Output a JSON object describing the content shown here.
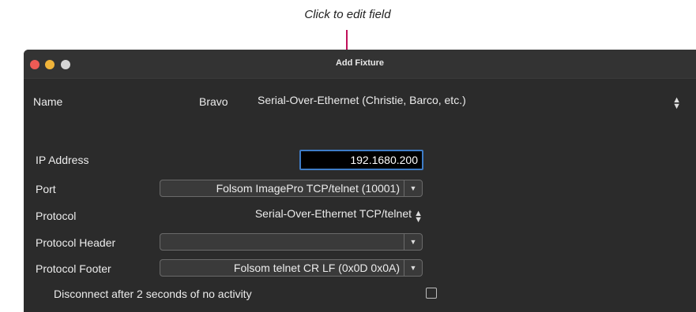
{
  "annotation": {
    "text": "Click to edit field"
  },
  "window": {
    "title": "Add Fixture"
  },
  "name_row": {
    "label": "Name",
    "value": "Bravo",
    "type_selected": "Serial-Over-Ethernet (Christie, Barco, etc.)"
  },
  "ip": {
    "label": "IP Address",
    "value": "192.1680.200"
  },
  "port": {
    "label": "Port",
    "selected": "Folsom ImagePro TCP/telnet (10001)"
  },
  "protocol": {
    "label": "Protocol",
    "selected": "Serial-Over-Ethernet TCP/telnet"
  },
  "protocol_header": {
    "label": "Protocol Header",
    "selected": ""
  },
  "protocol_footer": {
    "label": "Protocol Footer",
    "selected": "Folsom telnet CR LF (0x0D 0x0A)"
  },
  "disconnect": {
    "label": "Disconnect after 2 seconds of no activity",
    "checked": false
  },
  "colors": {
    "accent": "#3e7cc7",
    "callout": "#c0105a",
    "background": "#2b2b2b"
  }
}
